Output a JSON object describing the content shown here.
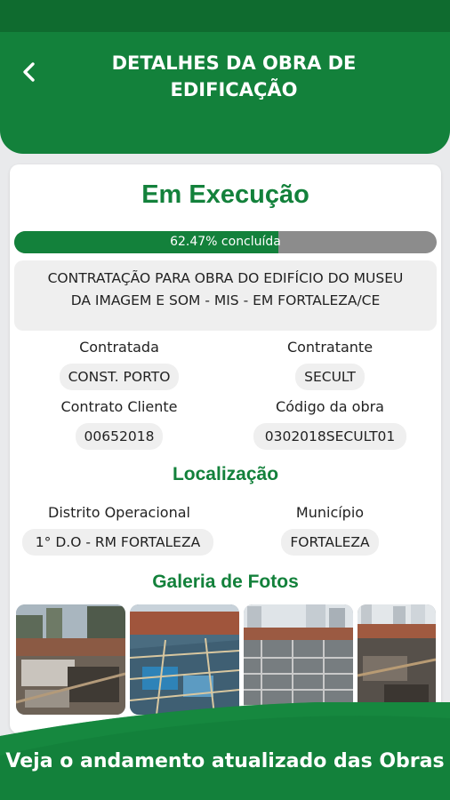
{
  "header": {
    "title_line1": "DETALHES DA OBRA DE",
    "title_line2": "EDIFICAÇÃO",
    "back_icon": "chevron-left-icon"
  },
  "status": "Em Execução",
  "progress": {
    "percent": 62.47,
    "label": "62.47% concluída"
  },
  "description": {
    "line1": "CONTRATAÇÃO PARA OBRA DO EDIFÍCIO DO MUSEU",
    "line2": "DA IMAGEM E SOM - MIS - EM FORTALEZA/CE"
  },
  "details": {
    "contratada_label": "Contratada",
    "contratada_value": "CONST. PORTO",
    "contratante_label": "Contratante",
    "contratante_value": "SECULT",
    "contrato_label": "Contrato Cliente",
    "contrato_value": "00652018",
    "codigo_label": "Código da obra",
    "codigo_value": "0302018SECULT01"
  },
  "localizacao": {
    "title": "Localização",
    "distrito_label": "Distrito Operacional",
    "distrito_value": "1° D.O - RM FORTALEZA",
    "municipio_label": "Município",
    "municipio_value": "FORTALEZA"
  },
  "galeria": {
    "title": "Galeria de Fotos",
    "photo_count": 4
  },
  "footer": {
    "text": "Veja o andamento atualizado das Obras"
  },
  "colors": {
    "brand_green": "#13813b",
    "dark_green": "#0f6b2f",
    "progress_track": "#8c8c8c",
    "pill_bg": "#efefef"
  }
}
